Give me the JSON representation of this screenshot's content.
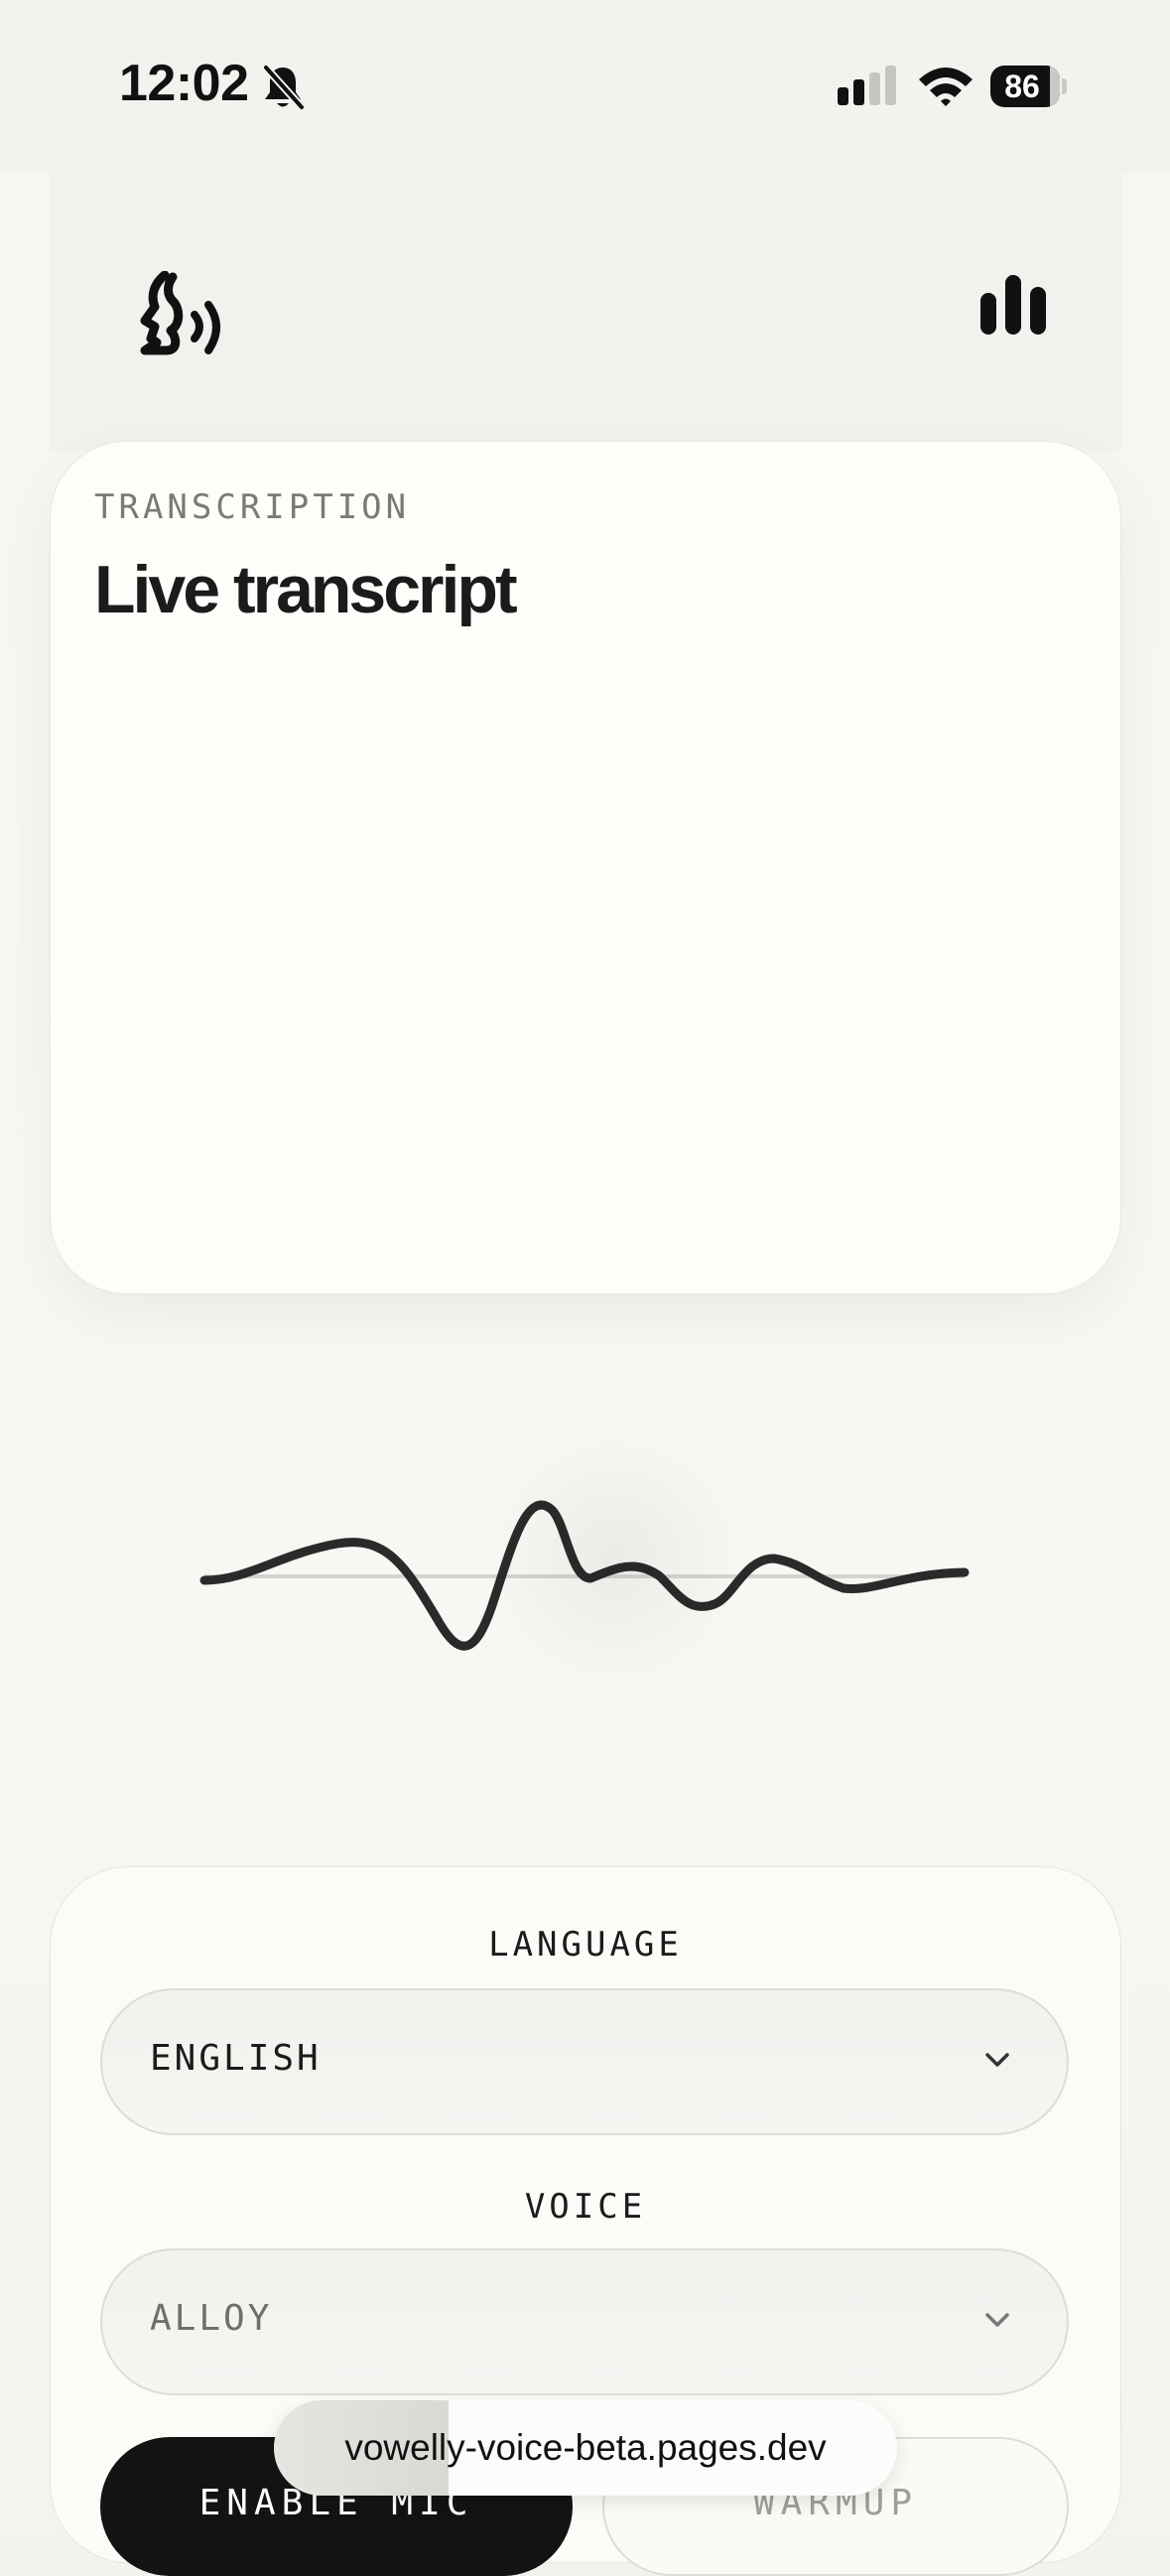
{
  "status_bar": {
    "time": "12:02",
    "battery": "86",
    "battery_level": 0.86,
    "icons": [
      "bell-slash-icon",
      "signal-icon",
      "wifi-icon",
      "battery-icon"
    ]
  },
  "header": {
    "logo_icon": "speaking-head-icon",
    "stats_icon": "bar-chart-icon"
  },
  "transcript": {
    "eyebrow": "TRANSCRIPTION",
    "title": "Live transcript",
    "content": ""
  },
  "waveform": {
    "color": "#2a2a2a",
    "baseline_color": "#d4d4d1"
  },
  "settings": {
    "language_label": "LANGUAGE",
    "language_value": "ENGLISH",
    "voice_label": "VOICE",
    "voice_value": "ALLOY",
    "enable_mic_label": "ENABLE MIC",
    "warmup_label": "WARMUP"
  },
  "browser": {
    "url": "vowelly-voice-beta.pages.dev",
    "load_progress": 0.28
  },
  "colors": {
    "background": "#f7f6f2",
    "card": "#fdfdfa",
    "primary_button": "#131313",
    "text": "#1b1b1b",
    "muted": "#7a7a76"
  }
}
